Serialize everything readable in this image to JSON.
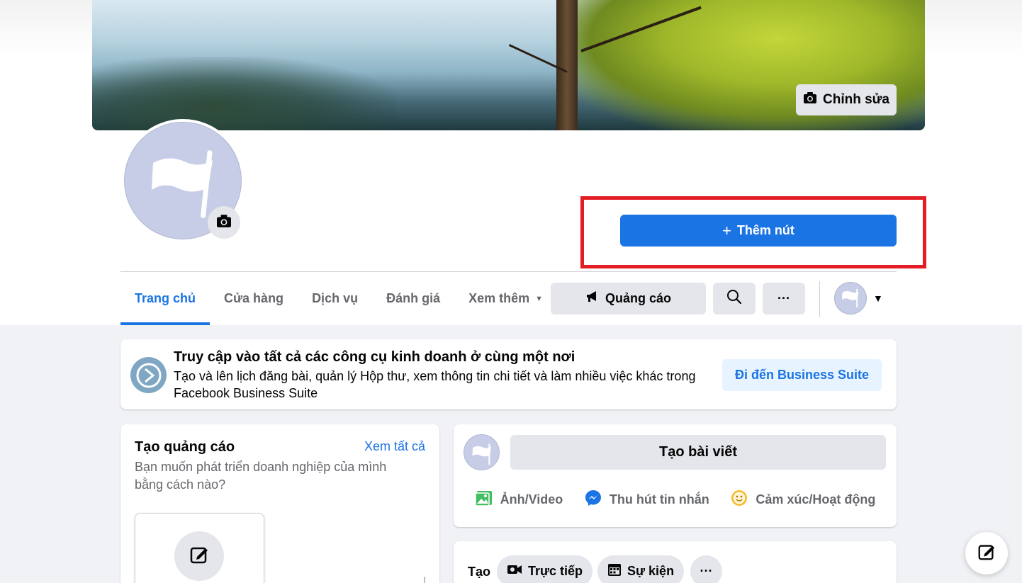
{
  "cover": {
    "edit_label": "Chỉnh sửa"
  },
  "actions": {
    "add_button_label": "Thêm nút",
    "add_button_icon": "+"
  },
  "tabs": [
    {
      "label": "Trang chủ",
      "active": true
    },
    {
      "label": "Cửa hàng"
    },
    {
      "label": "Dịch vụ"
    },
    {
      "label": "Đánh giá"
    },
    {
      "label": "Xem thêm"
    }
  ],
  "toolbar": {
    "ads_label": "Quảng cáo",
    "more_label": "···"
  },
  "business_banner": {
    "title": "Truy cập vào tất cả các công cụ kinh doanh ở cùng một nơi",
    "description": "Tạo và lên lịch đăng bài, quản lý Hộp thư, xem thông tin chi tiết và làm nhiều việc khác trong Facebook Business Suite",
    "button_label": "Đi đến Business Suite"
  },
  "create_ad": {
    "title": "Tạo quảng cáo",
    "see_all": "Xem tất cả",
    "description": "Bạn muốn phát triển doanh nghiệp của mình bằng cách nào?"
  },
  "composer": {
    "create_post": "Tạo bài viết",
    "actions": [
      "Ảnh/Video",
      "Thu hút tin nhắn",
      "Cảm xúc/Hoạt động"
    ]
  },
  "create_bar": {
    "label": "Tạo",
    "chips": [
      "Trực tiếp",
      "Sự kiện"
    ],
    "more": "···"
  },
  "colors": {
    "accent": "#1b74e4",
    "highlight_border": "#e41d24",
    "page_bg": "#f0f2f5"
  }
}
